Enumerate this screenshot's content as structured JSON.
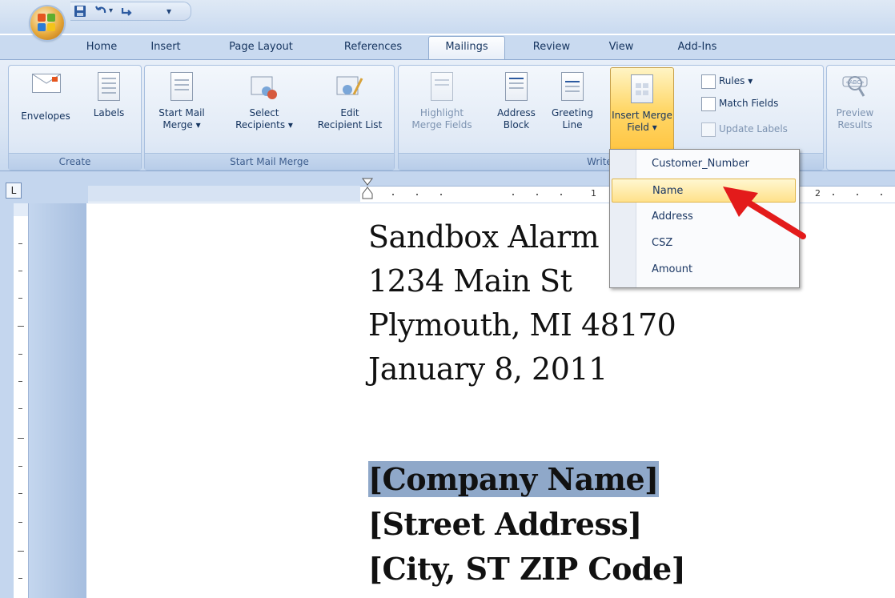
{
  "quick_access": {
    "dropdown_glyph": "▾"
  },
  "tabs": [
    "Home",
    "Insert",
    "Page Layout",
    "References",
    "Mailings",
    "Review",
    "View",
    "Add-Ins"
  ],
  "active_tab": "Mailings",
  "ribbon": {
    "create": {
      "label": "Create",
      "envelopes": "Envelopes",
      "labels": "Labels"
    },
    "start_mail_merge": {
      "label": "Start Mail Merge",
      "start_l1": "Start Mail",
      "start_l2": "Merge ▾",
      "select_l1": "Select",
      "select_l2": "Recipients ▾",
      "edit_l1": "Edit",
      "edit_l2": "Recipient List"
    },
    "write_insert": {
      "label": "Write & In",
      "highlight_l1": "Highlight",
      "highlight_l2": "Merge Fields",
      "address_l1": "Address",
      "address_l2": "Block",
      "greeting_l1": "Greeting",
      "greeting_l2": "Line",
      "insert_l1": "Insert Merge",
      "insert_l2": "Field ▾",
      "rules": "Rules ▾",
      "match_fields": "Match Fields",
      "update_labels": "Update Labels"
    },
    "preview": {
      "l1": "Preview",
      "l2": "Results",
      "abc_icon_text": "«ABC»"
    }
  },
  "ruler": {
    "corner_glyph": "L",
    "numbers": [
      "1",
      "1",
      "2"
    ]
  },
  "merge_field_menu": {
    "items": [
      "Customer_Number",
      "Name",
      "Address",
      "CSZ",
      "Amount"
    ],
    "highlighted": "Name"
  },
  "document": {
    "lines": [
      "Sandbox Alarm",
      "1234 Main St",
      "Plymouth, MI 48170",
      "January 8, 2011"
    ],
    "bold_lines": [
      "[Company Name]",
      "[Street Address]",
      "[City, ST  ZIP Code]"
    ]
  },
  "colors": {
    "accent_arrow": "#e31b1b",
    "selection": "#8fa8c9",
    "menu_highlight": "#ffe18a"
  }
}
